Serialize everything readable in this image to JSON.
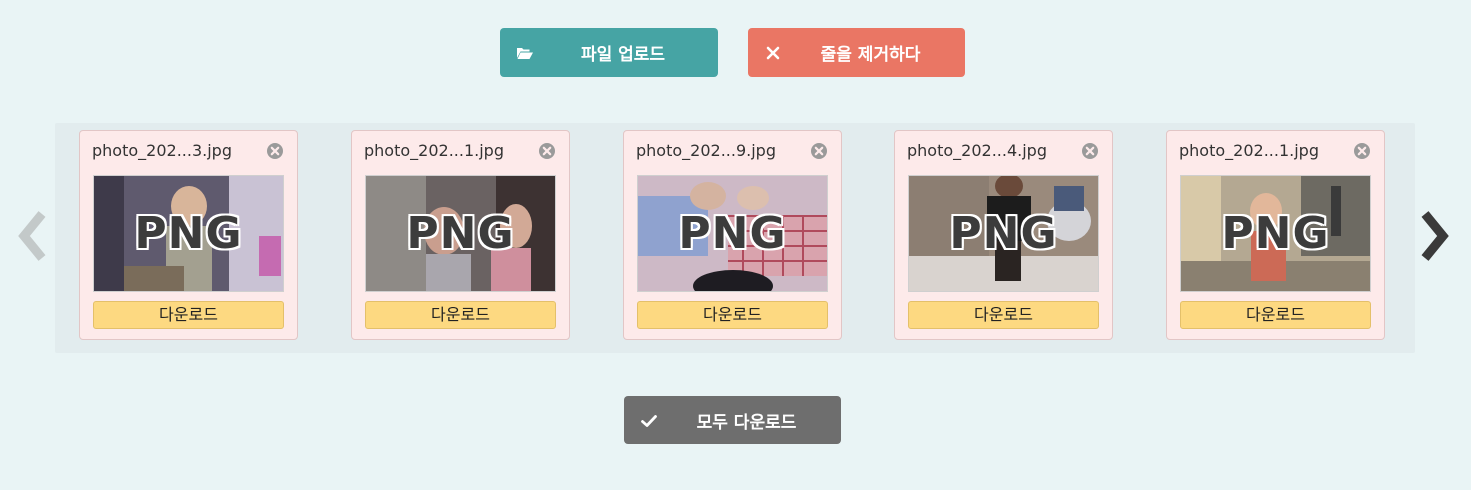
{
  "toolbar": {
    "upload_label": "파일 업로드",
    "clear_label": "줄을 제거하다",
    "upload_color": "#46a4a4",
    "clear_color": "#ea7664"
  },
  "files": [
    {
      "name": "photo_202...3.jpg",
      "badge": "PNG",
      "download_label": "다운로드"
    },
    {
      "name": "photo_202...1.jpg",
      "badge": "PNG",
      "download_label": "다운로드"
    },
    {
      "name": "photo_202...9.jpg",
      "badge": "PNG",
      "download_label": "다운로드"
    },
    {
      "name": "photo_202...4.jpg",
      "badge": "PNG",
      "download_label": "다운로드"
    },
    {
      "name": "photo_202...1.jpg",
      "badge": "PNG",
      "download_label": "다운로드"
    }
  ],
  "footer": {
    "download_all_label": "모두 다운로드",
    "download_all_color": "#6e6e6e"
  },
  "icons": {
    "upload": "folder-open-icon",
    "clear": "close-icon",
    "remove": "remove-circle-icon",
    "download_all": "check-icon",
    "prev": "chevron-left-icon",
    "next": "chevron-right-icon"
  }
}
